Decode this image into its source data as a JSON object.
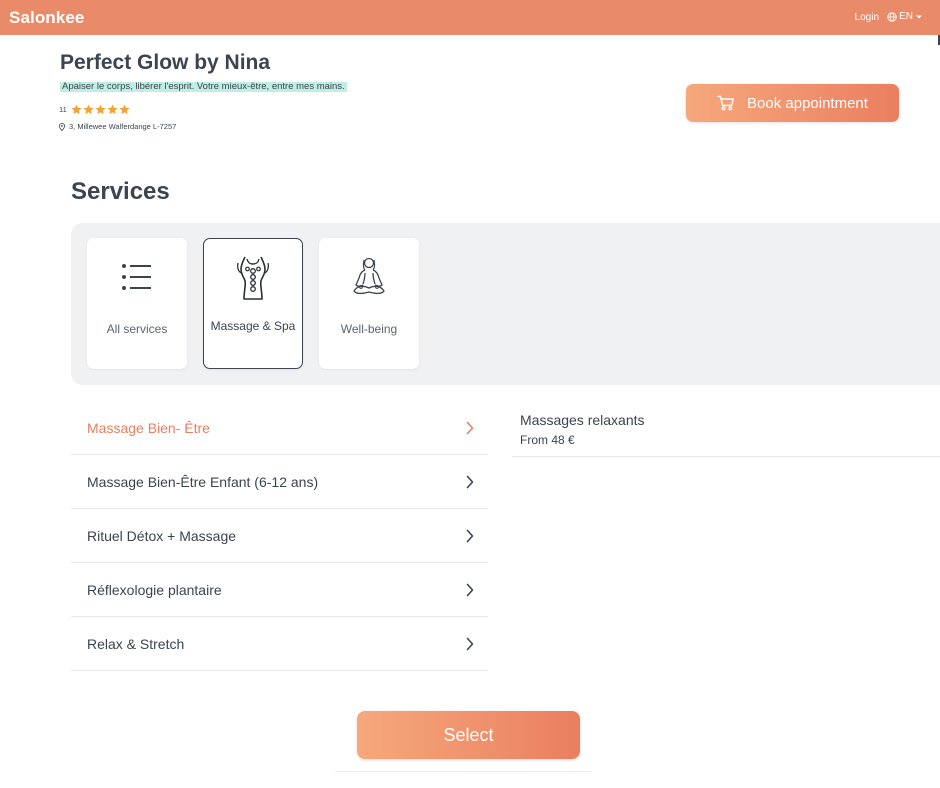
{
  "topbar": {
    "brand": "Salonkee",
    "login": "Login",
    "language": "EN"
  },
  "salon": {
    "name": "Perfect Glow by Nina",
    "tagline": "Apaiser le corps, libérer l'esprit. Votre mieux-être, entre mes mains.",
    "rating_count": "11",
    "rating": 5,
    "address": "3, Millewee Walferdange L-7257"
  },
  "book_button": {
    "label": "Book appointment",
    "icon": "cart-icon"
  },
  "services": {
    "title": "Services",
    "categories": [
      {
        "label": "All services",
        "icon": "list-icon",
        "active": false
      },
      {
        "label": "Massage & Spa",
        "icon": "massage-icon",
        "active": true
      },
      {
        "label": "Well-being",
        "icon": "meditation-icon",
        "active": false
      }
    ],
    "items": [
      {
        "label": "Massage Bien- Être",
        "active": true
      },
      {
        "label": "Massage Bien-Être Enfant (6-12 ans)",
        "active": false
      },
      {
        "label": "Rituel Détox + Massage",
        "active": false
      },
      {
        "label": "Réflexologie plantaire",
        "active": false
      },
      {
        "label": "Relax & Stretch",
        "active": false
      }
    ],
    "detail": {
      "name": "Massages relaxants",
      "price": "From 48 €"
    }
  },
  "select_button": {
    "label": "Select"
  },
  "colors": {
    "accent": "#e98b68",
    "text": "#3b4450",
    "star": "#f4a236",
    "highlight": "#bfeee2"
  }
}
